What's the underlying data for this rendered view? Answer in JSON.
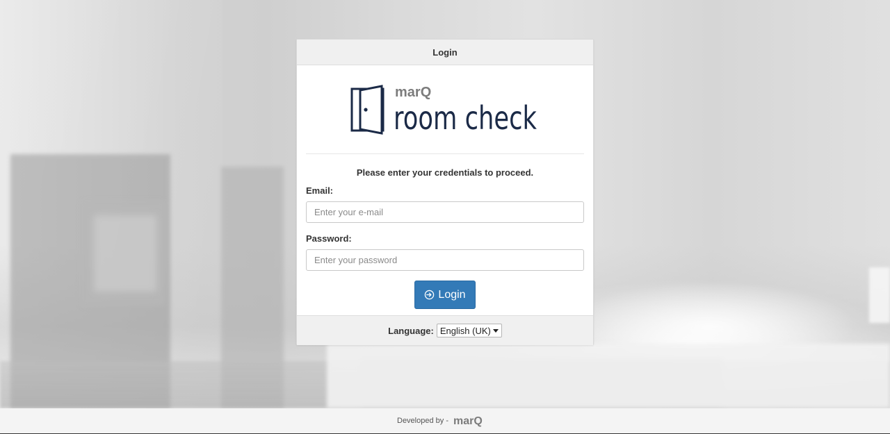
{
  "login_panel": {
    "header_title": "Login",
    "logo": {
      "brand_small": "marQ",
      "brand_large": "room check"
    },
    "intro_text": "Please enter your credentials to proceed.",
    "email": {
      "label": "Email:",
      "placeholder": "Enter your e-mail",
      "value": ""
    },
    "password": {
      "label": "Password:",
      "placeholder": "Enter your password",
      "value": ""
    },
    "login_button_label": "Login",
    "language": {
      "label": "Language:",
      "selected": "English (UK)"
    }
  },
  "page_footer": {
    "developed_by_text": "Developed by -",
    "brand": "marQ"
  },
  "colors": {
    "primary_button": "#337ab7",
    "logo_navy": "#1b2a47",
    "logo_grey": "#7c7c7c"
  }
}
